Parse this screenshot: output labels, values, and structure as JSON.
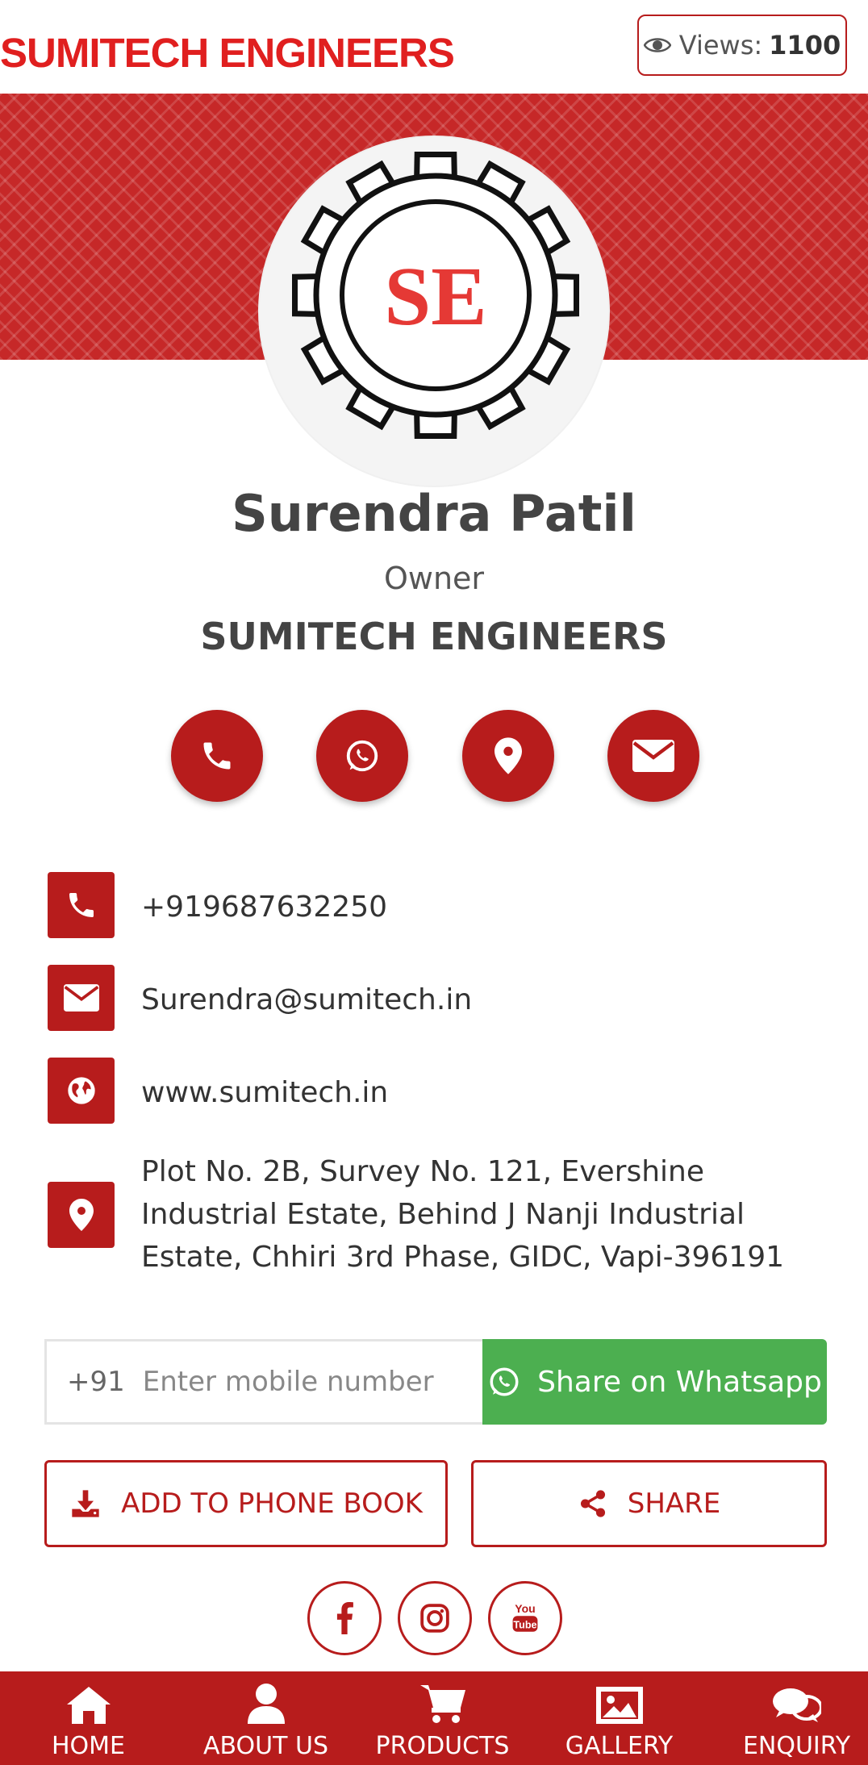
{
  "header": {
    "brand": "SUMITECH ENGINEERS",
    "views_label": "Views:",
    "views_count": "1100"
  },
  "profile": {
    "logo_text": "SE",
    "name": "Surendra Patil",
    "role": "Owner",
    "company": "SUMITECH ENGINEERS"
  },
  "quick_actions": [
    "phone-icon",
    "whatsapp-icon",
    "location-pin-icon",
    "envelope-icon"
  ],
  "contact": {
    "phone": "+919687632250",
    "email": "Surendra@sumitech.in",
    "website": "www.sumitech.in",
    "address_line1": "Plot No. 2B, Survey No. 121, Evershine",
    "address_line2": "Industrial Estate, Behind J Nanji Industrial",
    "address_line3": "Estate, Chhiri 3rd Phase, GIDC, Vapi-396191"
  },
  "share": {
    "prefix": "+91",
    "placeholder": "Enter mobile number",
    "button": "Share on Whatsapp"
  },
  "actions": {
    "add_to_phonebook": "ADD TO PHONE BOOK",
    "share": "SHARE"
  },
  "social": [
    "facebook-icon",
    "instagram-icon",
    "youtube-icon"
  ],
  "nav": [
    {
      "label": "HOME",
      "icon": "home-icon"
    },
    {
      "label": "ABOUT US",
      "icon": "user-icon"
    },
    {
      "label": "PRODUCTS",
      "icon": "cart-icon"
    },
    {
      "label": "GALLERY",
      "icon": "image-icon"
    },
    {
      "label": "ENQUIRY",
      "icon": "chat-icon"
    }
  ],
  "colors": {
    "primary": "#b71c1c",
    "brand_text": "#e01f1f",
    "whatsapp": "#4caf50"
  }
}
